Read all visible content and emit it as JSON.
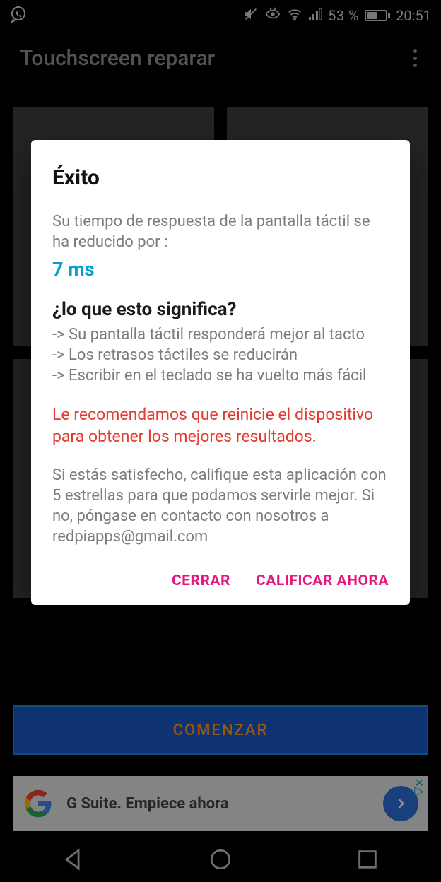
{
  "status": {
    "battery_pct": "53 %",
    "time": "20:51"
  },
  "header": {
    "title": "Touchscreen reparar"
  },
  "dialog": {
    "title": "Éxito",
    "intro": "Su tiempo de respuesta de la pantalla táctil se ha reducido por :",
    "value": "7 ms",
    "meaning_title": "¿lo que esto significa?",
    "bullets": [
      "-> Su pantalla táctil responderá mejor al tacto",
      "-> Los retrasos táctiles se reducirán",
      "-> Escribir en el teclado se ha vuelto más fácil"
    ],
    "warning": "Le recomendamos que reinicie el dispositivo para obtener los mejores resultados.",
    "rate_text": "Si estás satisfecho, califique esta aplicación con 5 estrellas para que podamos servirle mejor. Si no, póngase en contacto con nosotros a redpiapps@gmail.com",
    "close_label": "CERRAR",
    "rate_label": "CALIFICAR AHORA"
  },
  "main": {
    "start_label": "COMENZAR"
  },
  "ad": {
    "text": "G Suite. Empiece ahora"
  }
}
